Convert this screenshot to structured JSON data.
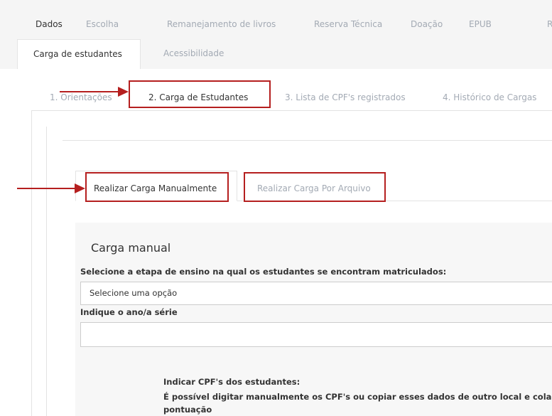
{
  "main_tabs": [
    {
      "label": "Dados",
      "active": true
    },
    {
      "label": "Escolha",
      "active": false
    },
    {
      "label": "Remanejamento de livros",
      "active": false
    },
    {
      "label": "Reserva Técnica",
      "active": false
    },
    {
      "label": "Doação",
      "active": false
    },
    {
      "label": "EPUB",
      "active": false
    },
    {
      "label": "R",
      "active": false
    }
  ],
  "sub_tabs": [
    {
      "label": "Carga de estudantes",
      "active": true
    },
    {
      "label": "Acessibilidade",
      "active": false
    }
  ],
  "steps": [
    {
      "label": "1. Orientações",
      "active": false
    },
    {
      "label": "2. Carga de Estudantes",
      "active": true
    },
    {
      "label": "3. Lista de CPF's registrados",
      "active": false
    },
    {
      "label": "4. Histórico de Cargas",
      "active": false
    }
  ],
  "inner_tabs": [
    {
      "label": "Realizar Carga Manualmente",
      "active": true
    },
    {
      "label": "Realizar Carga Por Arquivo",
      "active": false
    }
  ],
  "form": {
    "title": "Carga manual",
    "etapa_label": "Selecione a etapa de ensino na qual os estudantes se encontram matriculados:",
    "etapa_value": "Selecione uma opção",
    "ano_label": "Indique o ano/a série",
    "ano_value": "",
    "cpf_label": "Indicar CPF's dos estudantes:",
    "cpf_help_line1": "É possível digitar manualmente os CPF's ou copiar esses dados de outro local e cola",
    "cpf_help_line2": "pontuação"
  },
  "colors": {
    "annotation_red": "#b51f1f",
    "inactive_text": "#a3aab4",
    "active_text": "#333333",
    "top_background": "#f5f5f5",
    "panel_background": "#f7f7f7"
  }
}
